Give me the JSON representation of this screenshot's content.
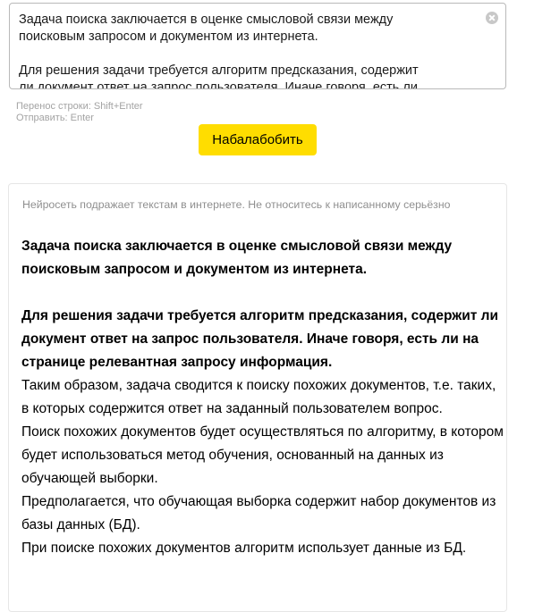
{
  "input": {
    "line1": "Задача поиска заключается в оценке смысловой связи между",
    "line2": "поисковым запросом и документом из интернета.",
    "line3": "Для решения задачи требуется алгоритм предсказания, содержит",
    "line4": "ли документ ответ на запрос пользователя. Иначе говоря, есть ли"
  },
  "hints": {
    "newline": "Перенос строки: Shift+Enter",
    "send": "Отправить: Enter"
  },
  "submit_label": "Набалабобить",
  "result": {
    "disclaimer": "Нейросеть подражает текстам в интернете. Не относитесь к написанному серьёзно",
    "bold_p1": "Задача поиска заключается в оценке смысловой связи между поисковым запросом и документом из интернета.",
    "bold_p2": "Для решения задачи требуется алгоритм предсказания, содержит ли документ ответ на запрос пользователя. Иначе говоря, есть ли на странице релевантная запросу информация.",
    "p3": "Таким образом, задача сводится к поиску похожих документов, т.е. таких, в которых содержится ответ на заданный пользователем вопрос.",
    "p4": "Поиск похожих документов будет осуществляться по алгоритму, в котором будет использоваться метод обучения, основанный на данных из обучающей выборки.",
    "p5": "Предполагается, что обучающая выборка содержит набор документов из базы данных (БД).",
    "p6": "При поиске похожих документов алгоритм использует данные из БД."
  }
}
